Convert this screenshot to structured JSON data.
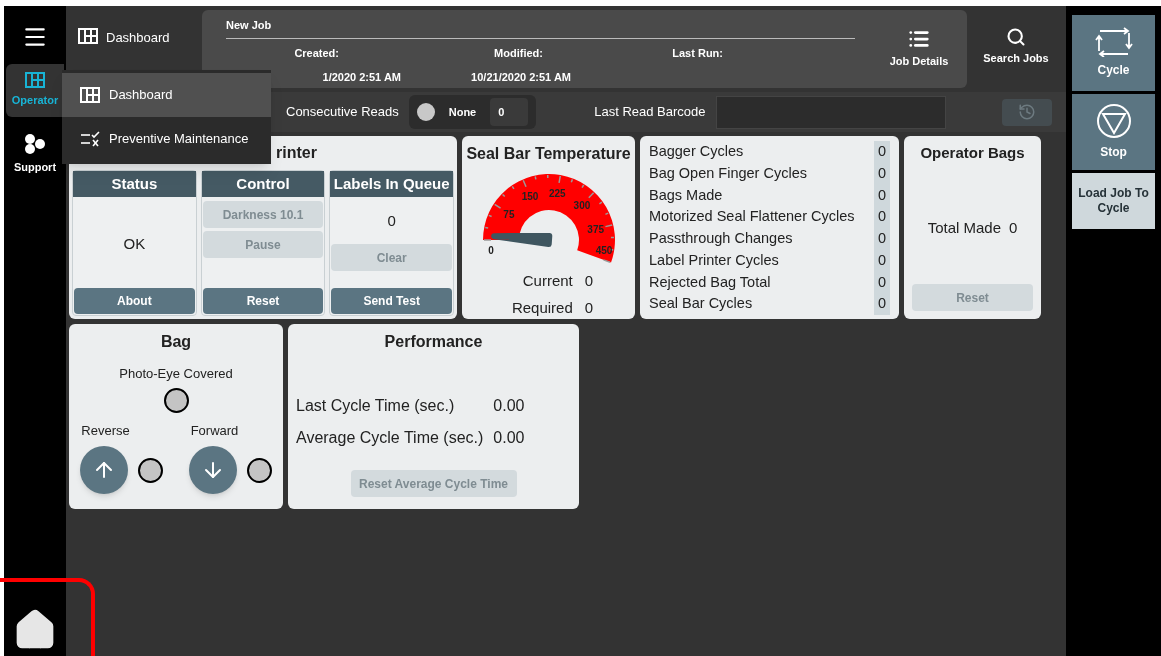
{
  "sidebar": {
    "items": [
      {
        "label": "Operator",
        "kind": "grid",
        "selected": true
      },
      {
        "label": "Support",
        "kind": "hex",
        "selected": false
      }
    ]
  },
  "breadcrumb": "Dashboard",
  "menu": {
    "items": [
      {
        "label": "Dashboard",
        "kind": "grid",
        "selected": true
      },
      {
        "label": "Preventive Maintenance",
        "kind": "checklist",
        "selected": false
      }
    ]
  },
  "job": {
    "name": "New Job",
    "fields": [
      {
        "label": "Created:",
        "value": "1/2020 2:51 AM"
      },
      {
        "label": "Modified:",
        "value": "10/21/2020 2:51 AM"
      },
      {
        "label": "Last Run:"
      }
    ]
  },
  "toolbar": [
    {
      "label": "Job Details",
      "kind": "list"
    },
    {
      "label": "Search Jobs",
      "kind": "search"
    }
  ],
  "reads": {
    "label": "Consecutive Reads",
    "status": "None",
    "count": "0",
    "barcode_label": "Last Read Barcode",
    "history_disabled": true
  },
  "printer": {
    "title": "rinter",
    "columns": [
      {
        "title": "Status",
        "value": "OK",
        "button": "About"
      },
      {
        "title": "Control",
        "controls": [
          {
            "label": "Darkness 10.1",
            "disabled": true
          },
          {
            "label": "Pause",
            "disabled": true
          }
        ],
        "button": "Reset"
      },
      {
        "title": "Labels In Queue",
        "value": "0",
        "controls": [
          {
            "label": "Clear",
            "disabled": true
          }
        ],
        "button": "Send Test"
      }
    ]
  },
  "seal_bar": {
    "title": "Seal Bar Temperature",
    "gauge_labels": [
      "0",
      "75",
      "150",
      "225",
      "300",
      "375",
      "450"
    ],
    "current_label": "Current",
    "current": "0",
    "required_label": "Required",
    "required": "0"
  },
  "counters": [
    {
      "label": "Bagger Cycles",
      "value": "0"
    },
    {
      "label": "Bag Open Finger Cycles",
      "value": "0"
    },
    {
      "label": "Bags Made",
      "value": "0"
    },
    {
      "label": "Motorized Seal Flattener Cycles",
      "value": "0"
    },
    {
      "label": "Passthrough Changes",
      "value": "0"
    },
    {
      "label": "Label Printer Cycles",
      "value": "0"
    },
    {
      "label": "Rejected Bag Total",
      "value": "0"
    },
    {
      "label": "Seal Bar Cycles",
      "value": "0"
    }
  ],
  "operator_bags": {
    "title": "Operator Bags",
    "total_label": "Total Made",
    "total": "0",
    "reset": {
      "label": "Reset",
      "disabled": true
    }
  },
  "bag": {
    "title": "Bag",
    "photo_eye": "Photo-Eye Covered",
    "photo_eye_on": false,
    "reverse": {
      "label": "Reverse",
      "on": false
    },
    "forward": {
      "label": "Forward",
      "on": false
    }
  },
  "performance": {
    "title": "Performance",
    "rows": [
      {
        "label": "Last Cycle Time (sec.)",
        "value": "0.00"
      },
      {
        "label": "Average Cycle Time (sec.)",
        "value": "0.00"
      }
    ],
    "reset": {
      "label": "Reset Average Cycle Time",
      "disabled": true
    }
  },
  "actions": [
    {
      "label": "Cycle",
      "kind": "cycle"
    },
    {
      "label": "Stop",
      "kind": "stop"
    },
    {
      "label": "Load Job To Cycle",
      "kind": "text"
    }
  ]
}
